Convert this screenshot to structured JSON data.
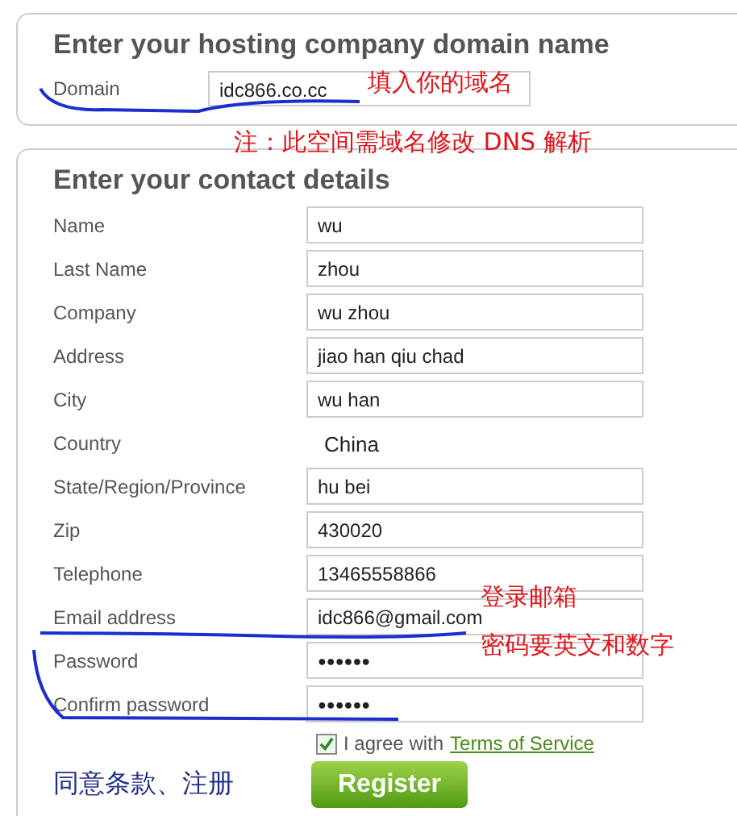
{
  "domain_section": {
    "title": "Enter your hosting company domain name",
    "field": {
      "label": "Domain",
      "value": "idc866.co.cc"
    },
    "annotation": "填入你的域名"
  },
  "note": "注：此空间需域名修改 DNS 解析",
  "contact_section": {
    "title": "Enter your contact details",
    "fields": [
      {
        "label": "Name",
        "value": "wu",
        "kind": "text"
      },
      {
        "label": "Last Name",
        "value": "zhou",
        "kind": "text"
      },
      {
        "label": "Company",
        "value": "wu zhou",
        "kind": "text"
      },
      {
        "label": "Address",
        "value": "jiao han qiu chad",
        "kind": "text"
      },
      {
        "label": "City",
        "value": "wu han",
        "kind": "text"
      },
      {
        "label": "Country",
        "value": "China",
        "kind": "select"
      },
      {
        "label": "State/Region/Province",
        "value": "hu bei",
        "kind": "text"
      },
      {
        "label": "Zip",
        "value": "430020",
        "kind": "text"
      },
      {
        "label": "Telephone",
        "value": "13465558866",
        "kind": "text"
      },
      {
        "label": "Email address",
        "value": "idc866@gmail.com",
        "kind": "text"
      },
      {
        "label": "Password",
        "value": "●●●●●●",
        "kind": "password"
      },
      {
        "label": "Confirm password",
        "value": "●●●●●●",
        "kind": "password"
      }
    ],
    "annotations": [
      "登录邮箱",
      "密码要英文和数字"
    ],
    "agree": {
      "checked": true,
      "text": "I agree with",
      "link": "Terms of Service"
    },
    "register_button": "Register",
    "register_note": "同意条款、注册"
  }
}
